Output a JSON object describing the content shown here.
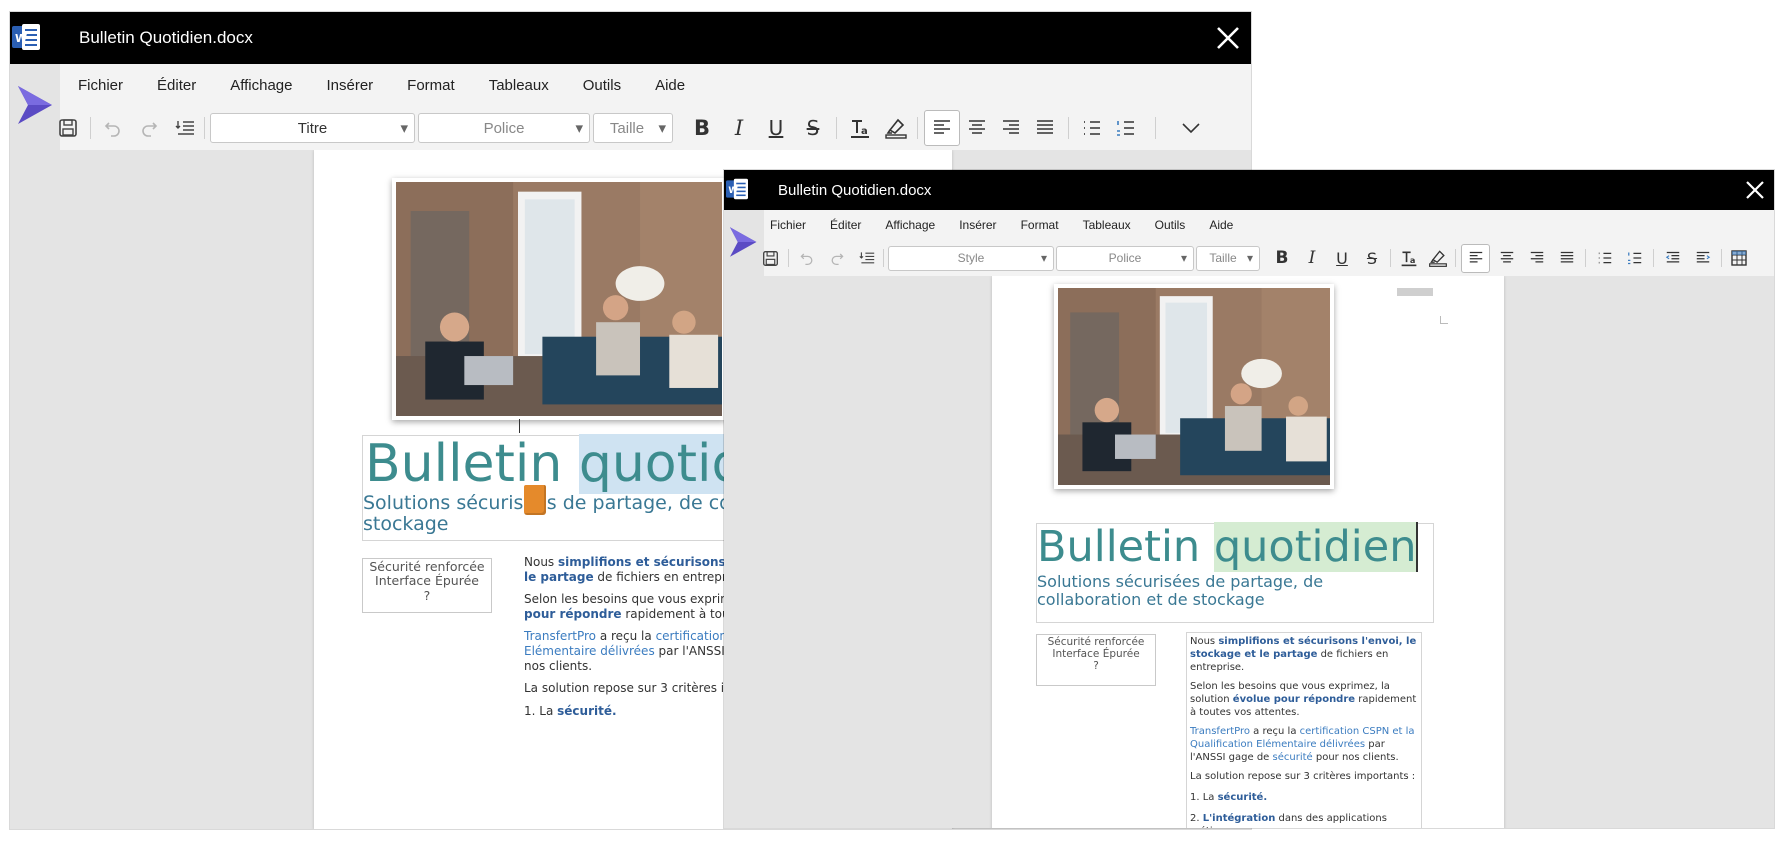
{
  "app": {
    "window_title": "Bulletin Quotidien.docx",
    "menu": [
      "Fichier",
      "Éditer",
      "Affichage",
      "Insérer",
      "Format",
      "Tableaux",
      "Outils",
      "Aide"
    ]
  },
  "back_window": {
    "style_combo": "Titre",
    "font_combo": "Police",
    "size_combo": "Taille"
  },
  "front_window": {
    "style_combo": "Style",
    "font_combo": "Police",
    "size_combo": "Taille"
  },
  "document": {
    "title_word1": "Bulletin",
    "title_word2": "quotidien",
    "subtitle": "Solutions sécurisées de partage, de collaboration et de stockage",
    "sidebox": {
      "line1": "Sécurité renforcée",
      "line2": "Interface Épurée",
      "line3": "?"
    },
    "p1": {
      "a": "Nous ",
      "b": "simplifions et sécurisons l'envoi, le stockage et le partage",
      "c": " de fichiers en entreprise."
    },
    "p2": {
      "a": "Selon les besoins que vous exprimez, la solution ",
      "b": "évolue pour répondre",
      "c": " rapidement à toutes vos attentes."
    },
    "p3": {
      "a": "TransfertPro",
      "b": " a reçu la ",
      "c": "certification CSPN et la Qualification Elémentaire délivrées",
      "d": " par l'ANSSI gage de ",
      "e": "sécurité",
      "f": " pour nos clients."
    },
    "p4": "La solution repose sur 3 critères importants :",
    "li1": {
      "num": "1. La ",
      "b": "sécurité."
    },
    "li2": {
      "num": "2. ",
      "b": "L'intégration",
      "c": " dans des applications métiers."
    }
  },
  "colors": {
    "title_teal": "#3d8c8e",
    "accent_blue": "#2e5d99",
    "logo_purple": "#5b4bc4"
  }
}
